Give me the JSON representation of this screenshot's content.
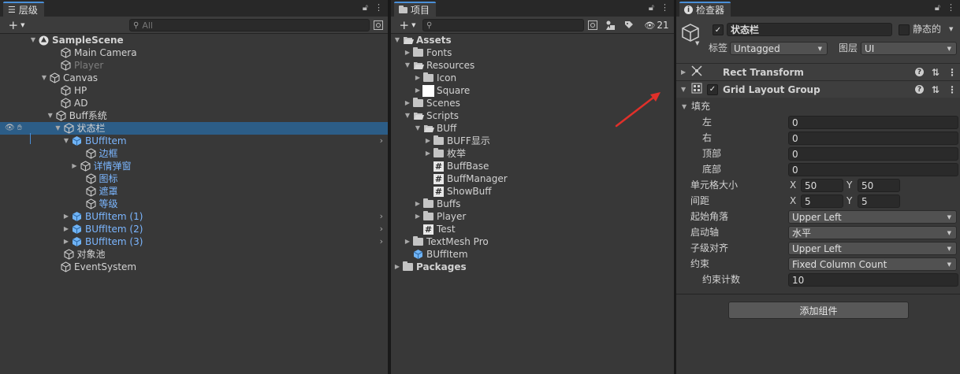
{
  "hierarchy": {
    "tab_label": "层级",
    "search_placeholder": "All",
    "rows": [
      {
        "label": "SampleScene",
        "depth": 0,
        "arrow": "down",
        "icon": "unity-scene-icon",
        "bold": true
      },
      {
        "label": "Main Camera",
        "depth": 2,
        "arrow": "",
        "icon": "cube-icon"
      },
      {
        "label": "Player",
        "depth": 2,
        "arrow": "",
        "icon": "cube-icon",
        "dim": true
      },
      {
        "label": "Canvas",
        "depth": 1,
        "arrow": "down",
        "icon": "cube-icon"
      },
      {
        "label": "HP",
        "depth": 2,
        "arrow": "",
        "icon": "cube-icon"
      },
      {
        "label": "AD",
        "depth": 2,
        "arrow": "",
        "icon": "cube-icon"
      },
      {
        "label": "Buff系统",
        "depth": 1.55,
        "arrow": "down",
        "icon": "cube-icon"
      },
      {
        "label": "状态栏",
        "depth": 2.25,
        "arrow": "down",
        "icon": "cube-icon",
        "selected": true
      },
      {
        "label": "BUffItem",
        "depth": 3.0,
        "arrow": "down",
        "icon": "prefab-icon",
        "blue": true,
        "chevron": true
      },
      {
        "label": "边框",
        "depth": 4.25,
        "arrow": "",
        "icon": "cube-icon",
        "blue": true
      },
      {
        "label": "详情弹窗",
        "depth": 3.75,
        "arrow": "right",
        "icon": "cube-icon",
        "blue": true
      },
      {
        "label": "图标",
        "depth": 4.25,
        "arrow": "",
        "icon": "cube-icon",
        "blue": true
      },
      {
        "label": "遮罩",
        "depth": 4.25,
        "arrow": "",
        "icon": "cube-icon",
        "blue": true
      },
      {
        "label": "等级",
        "depth": 4.25,
        "arrow": "",
        "icon": "cube-icon",
        "blue": true
      },
      {
        "label": "BUffItem (1)",
        "depth": 3.0,
        "arrow": "right",
        "icon": "prefab-icon",
        "blue": true,
        "chevron": true
      },
      {
        "label": "BUffItem (2)",
        "depth": 3.0,
        "arrow": "right",
        "icon": "prefab-icon",
        "blue": true,
        "chevron": true
      },
      {
        "label": "BUffItem (3)",
        "depth": 3.0,
        "arrow": "right",
        "icon": "prefab-icon",
        "blue": true,
        "chevron": true
      },
      {
        "label": "对象池",
        "depth": 2.25,
        "arrow": "",
        "icon": "cube-icon"
      },
      {
        "label": "EventSystem",
        "depth": 2,
        "arrow": "",
        "icon": "cube-icon"
      }
    ]
  },
  "project": {
    "tab_label": "项目",
    "hidden_count": "21",
    "rows": [
      {
        "label": "Assets",
        "depth": 0,
        "arrow": "down",
        "icon": "folder-open-icon",
        "bold": true
      },
      {
        "label": "Fonts",
        "depth": 1,
        "arrow": "right",
        "icon": "folder-icon"
      },
      {
        "label": "Resources",
        "depth": 1,
        "arrow": "down",
        "icon": "folder-open-icon"
      },
      {
        "label": "Icon",
        "depth": 2,
        "arrow": "right",
        "icon": "folder-icon"
      },
      {
        "label": "Square",
        "depth": 2,
        "arrow": "right",
        "icon": "sprite-icon"
      },
      {
        "label": "Scenes",
        "depth": 1,
        "arrow": "right",
        "icon": "folder-icon"
      },
      {
        "label": "Scripts",
        "depth": 1,
        "arrow": "down",
        "icon": "folder-open-icon"
      },
      {
        "label": "BUff",
        "depth": 2,
        "arrow": "down",
        "icon": "folder-open-icon"
      },
      {
        "label": "BUFF显示",
        "depth": 3,
        "arrow": "right",
        "icon": "folder-icon"
      },
      {
        "label": "枚举",
        "depth": 3,
        "arrow": "right",
        "icon": "folder-icon"
      },
      {
        "label": "BuffBase",
        "depth": 3,
        "arrow": "",
        "icon": "script-icon"
      },
      {
        "label": "BuffManager",
        "depth": 3,
        "arrow": "",
        "icon": "script-icon"
      },
      {
        "label": "ShowBuff",
        "depth": 3,
        "arrow": "",
        "icon": "script-icon"
      },
      {
        "label": "Buffs",
        "depth": 2,
        "arrow": "right",
        "icon": "folder-icon"
      },
      {
        "label": "Player",
        "depth": 2,
        "arrow": "right",
        "icon": "folder-icon"
      },
      {
        "label": "Test",
        "depth": 2,
        "arrow": "",
        "icon": "script-icon"
      },
      {
        "label": "TextMesh Pro",
        "depth": 1,
        "arrow": "right",
        "icon": "folder-icon"
      },
      {
        "label": "BUffItem",
        "depth": 1,
        "arrow": "",
        "icon": "prefab-icon"
      },
      {
        "label": "Packages",
        "depth": 0,
        "arrow": "right",
        "icon": "folder-icon",
        "bold": true
      }
    ]
  },
  "inspector": {
    "tab_label": "检查器",
    "object_name": "状态栏",
    "static_label": "静态的",
    "tag_label": "标签",
    "tag_value": "Untagged",
    "layer_label": "图层",
    "layer_value": "UI",
    "rect_transform": "Rect Transform",
    "grid_layout": "Grid Layout Group",
    "padding_label": "填充",
    "left_label": "左",
    "left_value": "0",
    "right_label": "右",
    "right_value": "0",
    "top_label": "顶部",
    "top_value": "0",
    "bottom_label": "底部",
    "bottom_value": "0",
    "cell_size_label": "单元格大小",
    "cell_x": "50",
    "cell_y": "50",
    "spacing_label": "间距",
    "spacing_x": "5",
    "spacing_y": "5",
    "x_label": "X",
    "y_label": "Y",
    "start_corner_label": "起始角落",
    "start_corner_value": "Upper Left",
    "start_axis_label": "启动轴",
    "start_axis_value": "水平",
    "child_align_label": "子级对齐",
    "child_align_value": "Upper Left",
    "constraint_label": "约束",
    "constraint_value": "Fixed Column Count",
    "constraint_count_label": "约束计数",
    "constraint_count_value": "10",
    "add_component": "添加组件"
  },
  "colors": {
    "accent": "#4a8fd8",
    "selection": "#2c5d87",
    "prefab_blue": "#7bb6ff",
    "annotation_arrow": "#e0302a"
  }
}
